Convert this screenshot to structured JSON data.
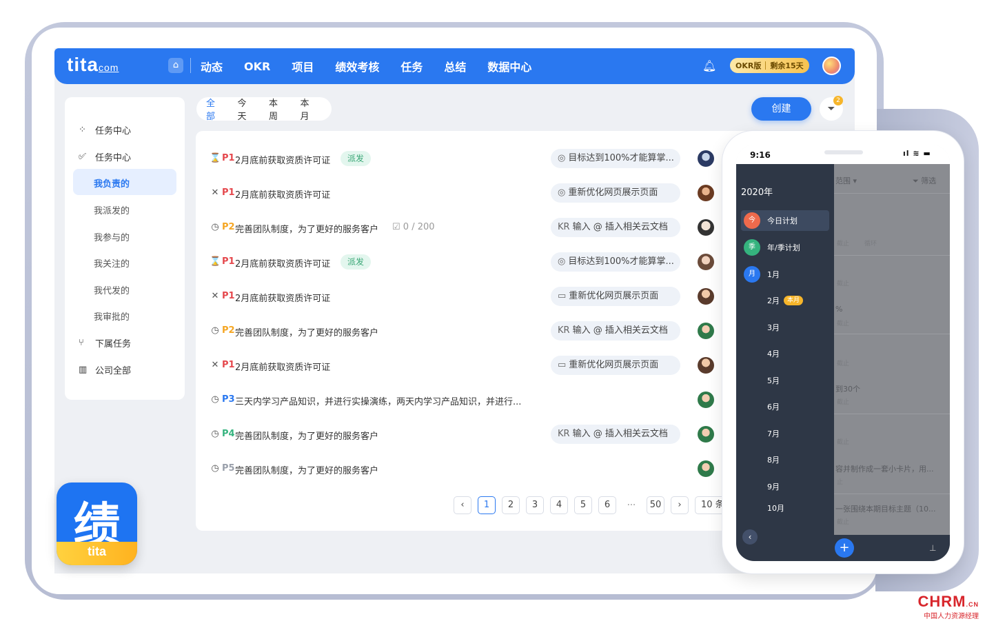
{
  "header": {
    "logo_main": "tita",
    "logo_suffix": "com",
    "home_icon": "home-icon",
    "nav": [
      "动态",
      "OKR",
      "项目",
      "绩效考核",
      "任务",
      "总结",
      "数据中心"
    ],
    "badge_left": "OKR版",
    "badge_right": "剩余15天"
  },
  "sidebar": {
    "group1": "任务中心",
    "group2": "任务中心",
    "items": [
      "我负责的",
      "我派发的",
      "我参与的",
      "我关注的",
      "我代发的",
      "我审批的"
    ],
    "group3": "下属任务",
    "group4": "公司全部"
  },
  "tabs": [
    "全部",
    "今天",
    "本周",
    "本月"
  ],
  "create_label": "创建",
  "filter_count": "2",
  "tasks": [
    {
      "icon": "⌛",
      "priority": "P1",
      "title": "2月底前获取资质许可证",
      "tag": "派发",
      "kr": "目标达到100%才能算掌...",
      "kr_icon": "◎"
    },
    {
      "icon": "✕",
      "priority": "P1",
      "title": "2月底前获取资质许可证",
      "kr": "重新优化网页展示页面",
      "kr_icon": "◎"
    },
    {
      "icon": "◷",
      "priority": "P2",
      "title": "完善团队制度，为了更好的服务客户",
      "progress": "0 / 200",
      "kr": "输入 @ 插入相关云文档",
      "kr_icon": "KR"
    },
    {
      "icon": "⌛",
      "priority": "P1",
      "title": "2月底前获取资质许可证",
      "tag": "派发",
      "kr": "目标达到100%才能算掌...",
      "kr_icon": "◎"
    },
    {
      "icon": "✕",
      "priority": "P1",
      "title": "2月底前获取资质许可证",
      "kr": "重新优化网页展示页面",
      "kr_icon": "▭"
    },
    {
      "icon": "◷",
      "priority": "P2",
      "title": "完善团队制度，为了更好的服务客户",
      "kr": "输入 @ 插入相关云文档",
      "kr_icon": "KR"
    },
    {
      "icon": "✕",
      "priority": "P1",
      "title": "2月底前获取资质许可证",
      "kr": "重新优化网页展示页面",
      "kr_icon": "▭"
    },
    {
      "icon": "◷",
      "priority": "P3",
      "title": "三天内学习产品知识，并进行实操演练，两天内学习产品知识，并进行..."
    },
    {
      "icon": "◷",
      "priority": "P4",
      "title": "完善团队制度，为了更好的服务客户",
      "kr": "输入 @ 插入相关云文档",
      "kr_icon": "KR"
    },
    {
      "icon": "◷",
      "priority": "P5",
      "title": "完善团队制度，为了更好的服务客户"
    }
  ],
  "priority_colors": {
    "P1": "#e5484d",
    "P2": "#f5a623",
    "P3": "#2a78f0",
    "P4": "#35b37e",
    "P5": "#9aa0ab"
  },
  "pagination": {
    "pages": [
      "1",
      "2",
      "3",
      "4",
      "5",
      "6"
    ],
    "dots": "···",
    "last": "50",
    "size": "10 条/"
  },
  "app_icon": {
    "glyph": "绩",
    "text": "tita"
  },
  "phone": {
    "time": "9:16",
    "year": "2020年",
    "items": [
      {
        "dot": "今",
        "label": "今日计划"
      },
      {
        "dot": "季",
        "label": "年/季计划"
      },
      {
        "dot": "月",
        "label": "1月"
      }
    ],
    "months": [
      "2月",
      "3月",
      "4月",
      "5月",
      "6月",
      "7月",
      "8月",
      "9月",
      "10月"
    ],
    "current_badge": "本月",
    "bg_texts": {
      "scope": "范围 ▾",
      "filter": "筛选",
      "t1": "截止",
      "t1b": "循环",
      "t2": "截止",
      "t3": "%",
      "t3b": "截止",
      "t4": "截止",
      "t5": "到30个",
      "t5b": "截止",
      "t6": "截止",
      "t7": "容并制作成一套小卡片，用...",
      "t7b": "止",
      "t8": "一张围绕本期目标主题（10...",
      "t8b": "截止"
    }
  },
  "watermark": {
    "top": "CHRM",
    "top_suffix": ".CN",
    "bottom": "中国人力资源经理"
  }
}
